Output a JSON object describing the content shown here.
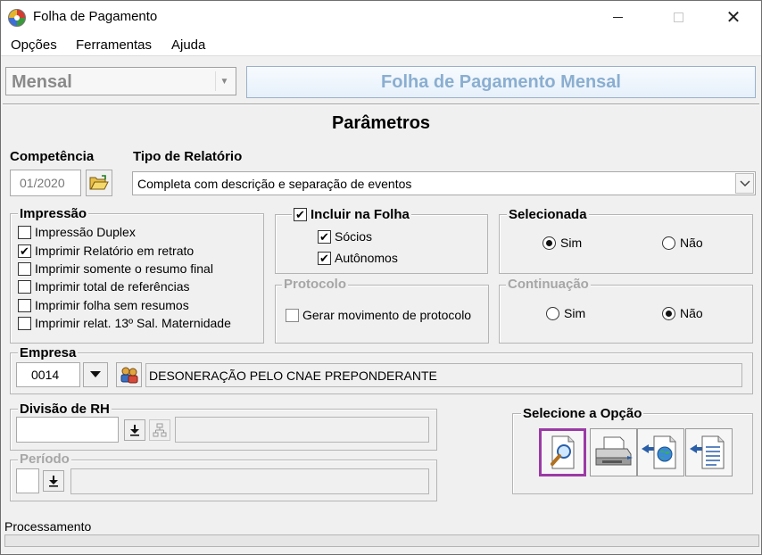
{
  "window": {
    "title": "Folha de Pagamento",
    "min_icon": "minimize-icon",
    "max_icon": "maximize-icon",
    "close_icon": "close-icon",
    "close_glyph": "✕"
  },
  "menu": {
    "items": [
      "Opções",
      "Ferramentas",
      "Ajuda"
    ]
  },
  "header": {
    "mode_value": "Mensal",
    "banner": "Folha de Pagamento Mensal"
  },
  "params": {
    "title": "Parâmetros",
    "competencia_label": "Competência",
    "competencia_value": "01/2020",
    "tipo_label": "Tipo de Relatório",
    "tipo_value": "Completa com descrição e separação de eventos"
  },
  "impressao": {
    "title": "Impressão",
    "options": [
      {
        "label": "Impressão Duplex",
        "checked": false
      },
      {
        "label": "Imprimir Relatório em retrato",
        "checked": true
      },
      {
        "label": "Imprimir somente o resumo final",
        "checked": false
      },
      {
        "label": "Imprimir total de referências",
        "checked": false
      },
      {
        "label": "Imprimir folha sem resumos",
        "checked": false
      },
      {
        "label": "Imprimir relat. 13º Sal. Maternidade",
        "checked": false
      }
    ]
  },
  "incluir": {
    "title": "Incluir na Folha",
    "checked": true,
    "options": [
      {
        "label": "Sócios",
        "checked": true
      },
      {
        "label": "Autônomos",
        "checked": true
      }
    ]
  },
  "selecionada": {
    "title": "Selecionada",
    "sim": "Sim",
    "nao": "Não",
    "value": "Sim"
  },
  "protocolo": {
    "title": "Protocolo",
    "option": "Gerar movimento de protocolo",
    "checked": false
  },
  "continuacao": {
    "title": "Continuação",
    "sim": "Sim",
    "nao": "Não",
    "value": "Não"
  },
  "empresa": {
    "title": "Empresa",
    "code": "0014",
    "name": "DESONERAÇÃO PELO CNAE PREPONDERANTE"
  },
  "divisao": {
    "title": "Divisão de RH",
    "code": "",
    "name": ""
  },
  "periodo": {
    "title": "Período",
    "code": "",
    "name": ""
  },
  "opcoes": {
    "title": "Selecione a Opção",
    "buttons": [
      "preview-icon",
      "printer-icon",
      "export-web-icon",
      "document-icon"
    ],
    "selected": "preview-icon"
  },
  "status": {
    "label": "Processamento",
    "progress": 0
  }
}
